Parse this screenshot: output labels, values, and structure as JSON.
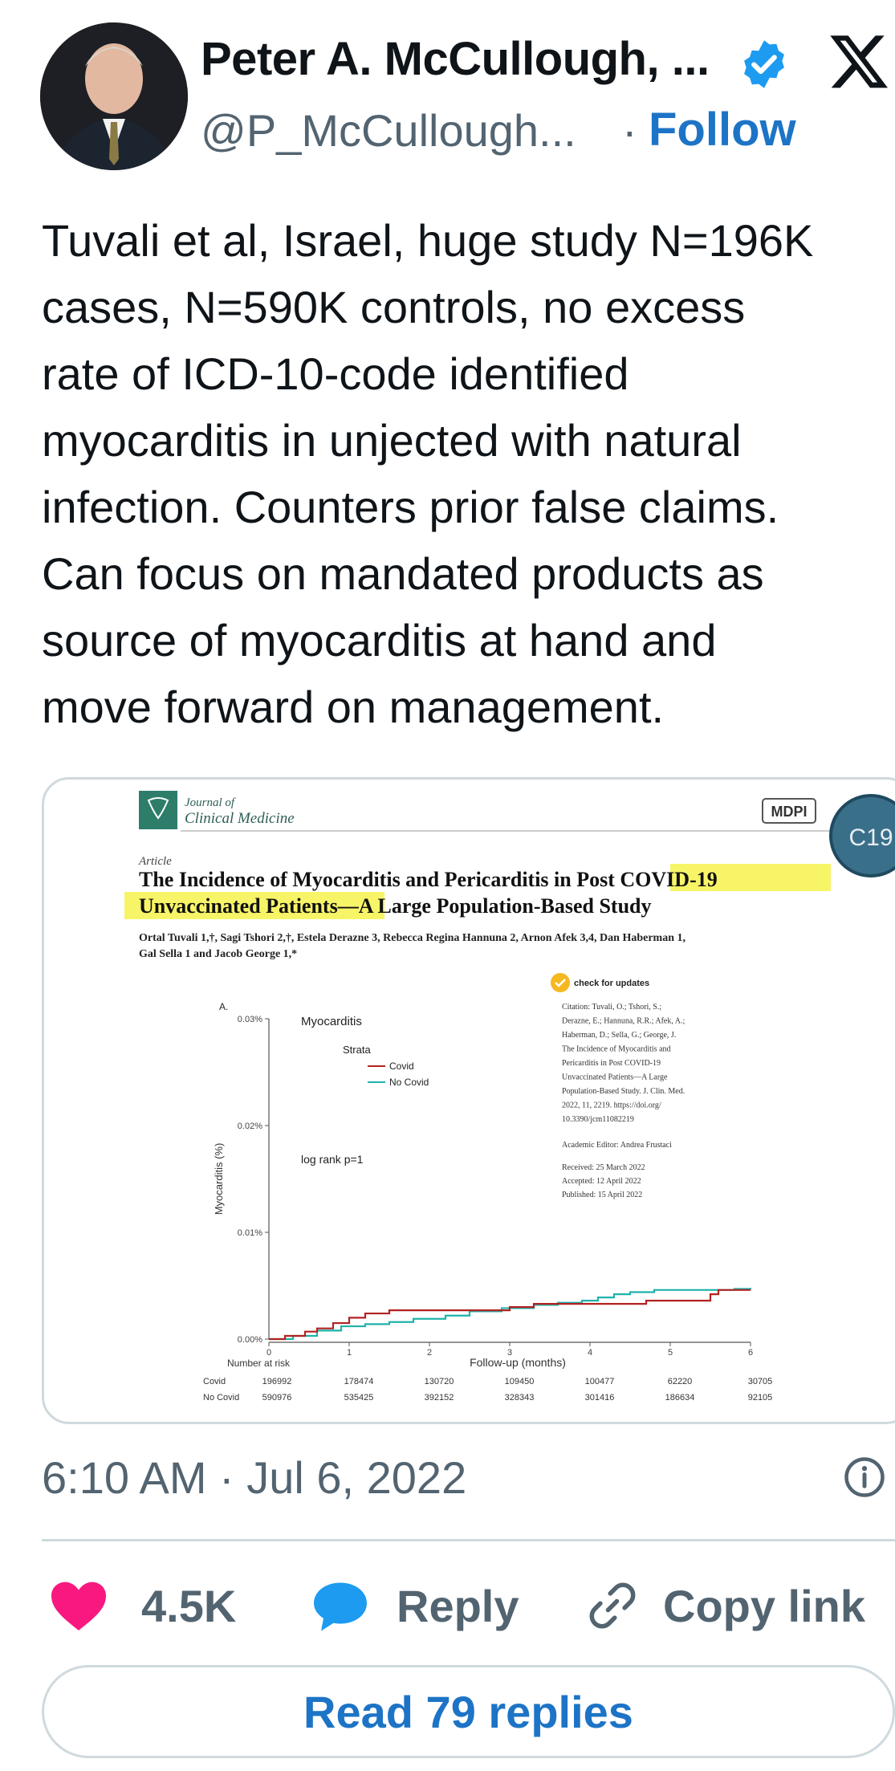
{
  "header": {
    "display_name": "Peter A. McCullough, ...",
    "handle": "@P_McCullough...",
    "separator": "·",
    "follow_label": "Follow"
  },
  "tweet": {
    "text": "Tuvali et al, Israel, huge study N=196K\ncases, N=590K controls, no excess\nrate of ICD-10-code identified\nmyocarditis in unjected with natural\ninfection.  Counters prior false claims.\nCan focus on mandated products as\nsource of myocarditis at hand and\nmove forward on management."
  },
  "card": {
    "journal_line1": "Journal of",
    "journal_line2": "Clinical Medicine",
    "publisher": "MDPI",
    "badge": "C19",
    "article_type": "Article",
    "title_line1_a": "The Incidence of Myocarditis and Pericarditis in Post ",
    "title_line1_b": "COVID-19",
    "title_line2_a": "Unvaccinated Patients",
    "title_line2_b": "—A Large Population-Based Study",
    "authors_line1": "Ortal Tuvali 1,†, Sagi Tshori 2,†, Estela Derazne 3, Rebecca Regina Hannuna 2, Arnon Afek 3,4, Dan Haberman 1,",
    "authors_line2": "Gal Sella 1 and Jacob George 1,*",
    "check_updates": "check for updates",
    "citation": [
      "Citation: Tuvali, O.; Tshori, S.;",
      "Derazne, E.; Hannuna, R.R.; Afek, A.;",
      "Haberman, D.; Sella, G.; George, J.",
      "The Incidence of Myocarditis and",
      "Pericarditis in Post COVID-19",
      "Unvaccinated Patients—A Large",
      "Population-Based Study. J. Clin. Med.",
      "2022, 11, 2219. https://doi.org/",
      "10.3390/jcm11082219"
    ],
    "editor": "Academic Editor: Andrea Frustaci",
    "received": "Received: 25 March 2022",
    "accepted": "Accepted: 12 April 2022",
    "published": "Published: 15 April 2022"
  },
  "chart_data": {
    "type": "line",
    "panel_label": "A.",
    "title": "Myocarditis",
    "xlabel": "Follow-up (months)",
    "ylabel": "Myocarditis (%)",
    "xlim": [
      0,
      6
    ],
    "ylim": [
      0,
      0.03
    ],
    "x_ticks": [
      "0",
      "1",
      "2",
      "3",
      "4",
      "5",
      "6"
    ],
    "y_ticks": [
      "0.00%",
      "0.01%",
      "0.02%",
      "0.03%"
    ],
    "legend_title": "Strata",
    "annotation": "log rank p=1",
    "colors": {
      "Covid": "#b22222",
      "No Covid": "#20b2aa"
    },
    "series": [
      {
        "name": "Covid",
        "x": [
          0,
          0.2,
          0.45,
          0.6,
          0.8,
          1.0,
          1.2,
          1.5,
          2.5,
          3.0,
          3.3,
          3.6,
          4.1,
          4.5,
          4.7,
          5.2,
          5.5,
          5.6,
          6.0
        ],
        "y": [
          0,
          0.0003,
          0.0007,
          0.001,
          0.0015,
          0.002,
          0.0024,
          0.0027,
          0.0027,
          0.003,
          0.0033,
          0.0033,
          0.0033,
          0.0033,
          0.0036,
          0.0036,
          0.0042,
          0.0046,
          0.0046
        ]
      },
      {
        "name": "No Covid",
        "x": [
          0,
          0.3,
          0.6,
          0.9,
          1.2,
          1.5,
          1.8,
          2.2,
          2.5,
          2.9,
          3.3,
          3.6,
          3.9,
          4.1,
          4.3,
          4.5,
          4.8,
          5.2,
          5.5,
          5.8,
          6.0
        ],
        "y": [
          0,
          0.0003,
          0.0008,
          0.0012,
          0.0014,
          0.0016,
          0.0019,
          0.0022,
          0.0026,
          0.0029,
          0.0032,
          0.0034,
          0.0036,
          0.0039,
          0.0042,
          0.0044,
          0.0046,
          0.0046,
          0.0046,
          0.0047,
          0.0048
        ]
      }
    ],
    "risk_table": {
      "label": "Number at risk",
      "rows": [
        {
          "name": "Covid",
          "values": [
            "196992",
            "178474",
            "130720",
            "109450",
            "100477",
            "62220",
            "30705"
          ]
        },
        {
          "name": "No Covid",
          "values": [
            "590976",
            "535425",
            "392152",
            "328343",
            "301416",
            "186634",
            "92105"
          ]
        }
      ]
    }
  },
  "footer": {
    "timestamp": "6:10 AM · Jul 6, 2022",
    "like_count": "4.5K",
    "reply_label": "Reply",
    "copy_label": "Copy link",
    "read_replies_label": "Read 79 replies",
    "like_color": "#f91880",
    "reply_color": "#1d9bf0",
    "link_color": "#1d74c6"
  }
}
